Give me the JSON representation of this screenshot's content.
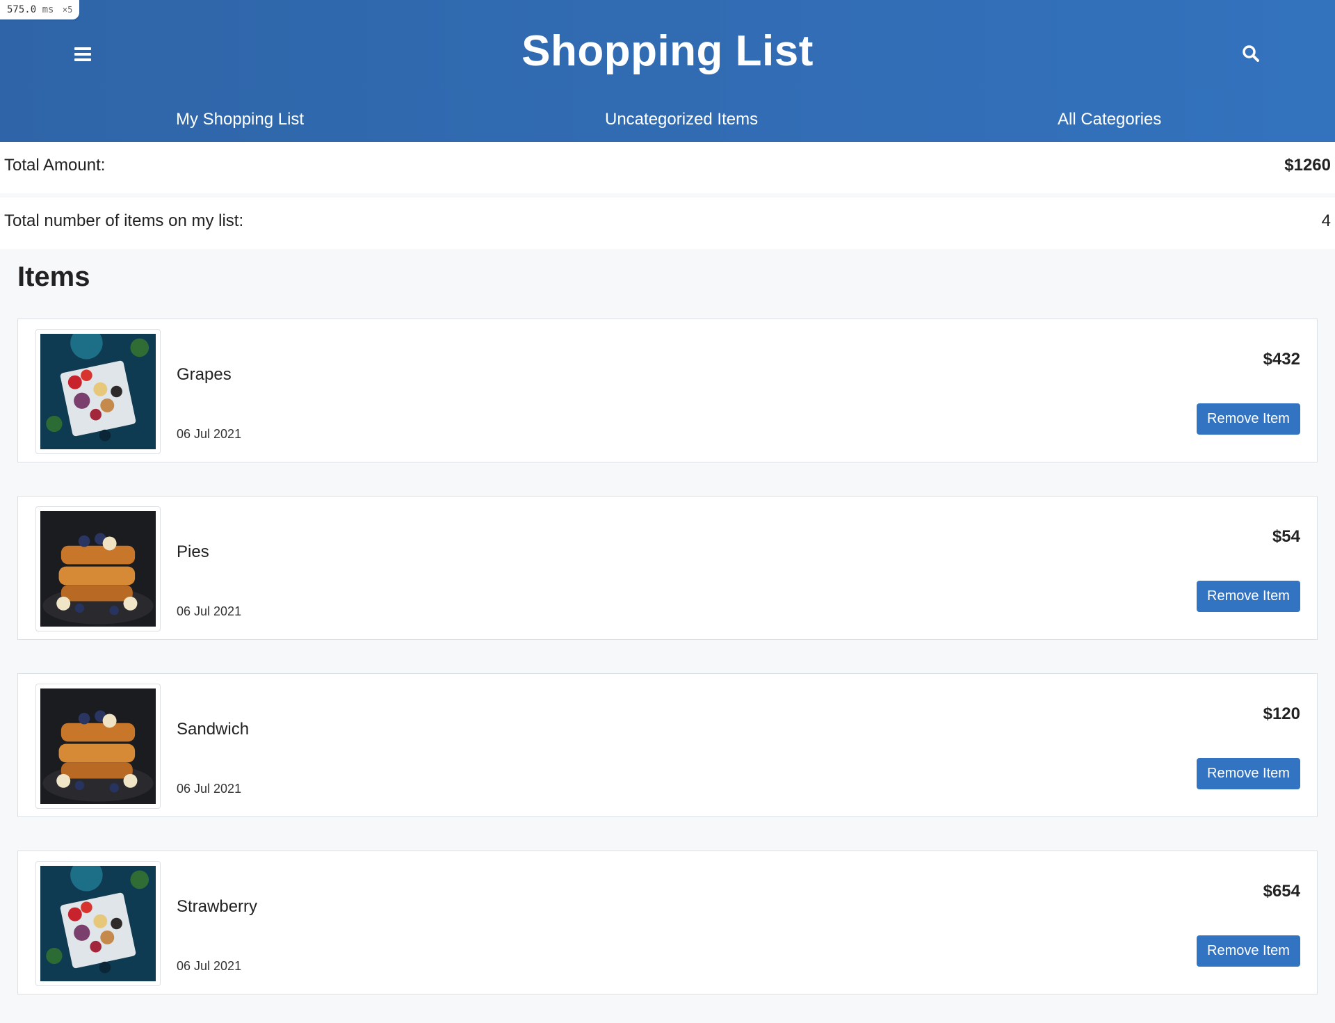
{
  "perf": {
    "value": "575.0",
    "unit": "ms",
    "multiplier": "×5"
  },
  "header": {
    "title": "Shopping List",
    "menu_icon": "hamburger-menu-icon",
    "search_icon": "search-icon",
    "colors": {
      "start": "#2f65a8",
      "end": "#3372bd"
    }
  },
  "tabs": [
    {
      "label": "My Shopping List"
    },
    {
      "label": "Uncategorized Items"
    },
    {
      "label": "All Categories"
    }
  ],
  "summary": {
    "total_amount_label": "Total Amount:",
    "total_amount_value": "$1260",
    "item_count_label": "Total number of items on my list:",
    "item_count_value": "4"
  },
  "items_heading": "Items",
  "items": [
    {
      "name": "Grapes",
      "date": "06 Jul 2021",
      "price": "$432",
      "action": "Remove Item",
      "image": "food-platter-thumbnail"
    },
    {
      "name": "Pies",
      "date": "06 Jul 2021",
      "price": "$54",
      "action": "Remove Item",
      "image": "french-toast-thumbnail"
    },
    {
      "name": "Sandwich",
      "date": "06 Jul 2021",
      "price": "$120",
      "action": "Remove Item",
      "image": "french-toast-thumbnail"
    },
    {
      "name": "Strawberry",
      "date": "06 Jul 2021",
      "price": "$654",
      "action": "Remove Item",
      "image": "food-platter-thumbnail"
    }
  ],
  "accent_color": "#3273c2"
}
